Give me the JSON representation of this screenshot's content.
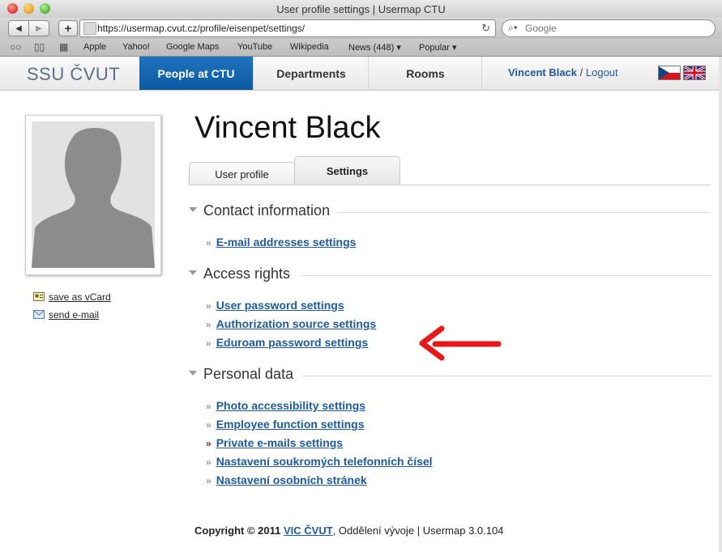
{
  "window": {
    "title": "User profile settings | Usermap CTU"
  },
  "browser": {
    "url": "https://usermap.cvut.cz/profile/eisenpet/settings/",
    "search_placeholder": "Google",
    "bookmarks": [
      "Apple",
      "Yahoo!",
      "Google Maps",
      "YouTube",
      "Wikipedia",
      "News (448)",
      "Popular"
    ]
  },
  "site": {
    "logo": "SSU ČVUT",
    "nav": [
      "People at CTU",
      "Departments",
      "Rooms"
    ],
    "active_nav": "People at CTU",
    "user_name": "Vincent Black",
    "separator": " / ",
    "logout": "Logout"
  },
  "sidebar": {
    "vcard": "save as vCard",
    "email": "send e-mail"
  },
  "profile": {
    "name": "Vincent Black",
    "tabs": [
      "User profile",
      "Settings"
    ],
    "active_tab": "Settings"
  },
  "sections": [
    {
      "title": "Contact information",
      "links": [
        "E-mail addresses settings"
      ]
    },
    {
      "title": "Access rights",
      "links": [
        "User password settings",
        "Authorization source settings",
        "Eduroam password settings"
      ]
    },
    {
      "title": "Personal data",
      "links": [
        "Photo accessibility settings",
        "Employee function settings",
        "Private e-mails settings",
        "Nastavení soukromých telefonních čísel",
        "Nastavení osobních stránek"
      ]
    }
  ],
  "footer": {
    "copyright": "Copyright © 2011",
    "org": "VIC ČVUT",
    "rest": ", Oddělení vývoje | Usermap 3.0.104"
  },
  "colors": {
    "accent": "#1f72bd",
    "link": "#1f5a9a",
    "annotation": "#e8191a"
  }
}
